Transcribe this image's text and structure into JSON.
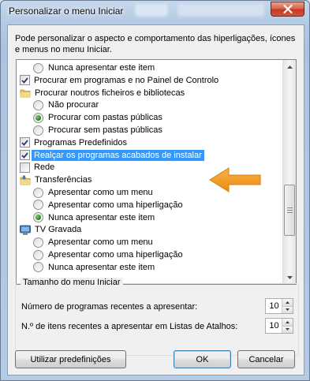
{
  "window": {
    "title": "Personalizar o menu Iniciar",
    "close_icon": "close-icon"
  },
  "description": "Pode personalizar o aspecto e comportamento das hiperligações, ícones e menus no menu Iniciar.",
  "list": {
    "items": [
      {
        "type": "radio",
        "indent": 1,
        "checked": false,
        "label": "Nunca apresentar este item"
      },
      {
        "type": "checkbox",
        "indent": 0,
        "checked": true,
        "label": "Procurar em programas e no Painel de Controlo"
      },
      {
        "type": "folder",
        "indent": 0,
        "label": "Procurar noutros ficheiros e bibliotecas"
      },
      {
        "type": "radio",
        "indent": 1,
        "checked": false,
        "label": "Não procurar"
      },
      {
        "type": "radio",
        "indent": 1,
        "checked": true,
        "label": "Procurar com pastas públicas"
      },
      {
        "type": "radio",
        "indent": 1,
        "checked": false,
        "label": "Procurar sem pastas públicas"
      },
      {
        "type": "checkbox",
        "indent": 0,
        "checked": true,
        "label": "Programas Predefinidos"
      },
      {
        "type": "checkbox",
        "indent": 0,
        "checked": true,
        "selected": true,
        "label": "Realçar os programas acabados de instalar"
      },
      {
        "type": "checkbox",
        "indent": 0,
        "checked": false,
        "label": "Rede"
      },
      {
        "type": "folder-download",
        "indent": 0,
        "label": "Transferências"
      },
      {
        "type": "radio",
        "indent": 1,
        "checked": false,
        "label": "Apresentar como um menu"
      },
      {
        "type": "radio",
        "indent": 1,
        "checked": false,
        "label": "Apresentar como uma hiperligação"
      },
      {
        "type": "radio",
        "indent": 1,
        "checked": true,
        "label": "Nunca apresentar este item"
      },
      {
        "type": "tv",
        "indent": 0,
        "label": "TV Gravada"
      },
      {
        "type": "radio",
        "indent": 1,
        "checked": false,
        "label": "Apresentar como um menu"
      },
      {
        "type": "radio",
        "indent": 1,
        "checked": false,
        "label": "Apresentar como uma hiperligação"
      },
      {
        "type": "radio",
        "indent": 1,
        "checked": false,
        "label": "Nunca apresentar este item"
      }
    ]
  },
  "size_group": {
    "title": "Tamanho do menu Iniciar",
    "recent_programs_label": "Número de programas recentes a apresentar:",
    "recent_programs_value": "10",
    "jump_list_label": "N.º de itens recentes a apresentar em Listas de Atalhos:",
    "jump_list_value": "10"
  },
  "buttons": {
    "defaults": "Utilizar predefinições",
    "ok": "OK",
    "cancel": "Cancelar"
  },
  "colors": {
    "selection": "#3399ff",
    "annotation_arrow": "#f39a1e"
  }
}
